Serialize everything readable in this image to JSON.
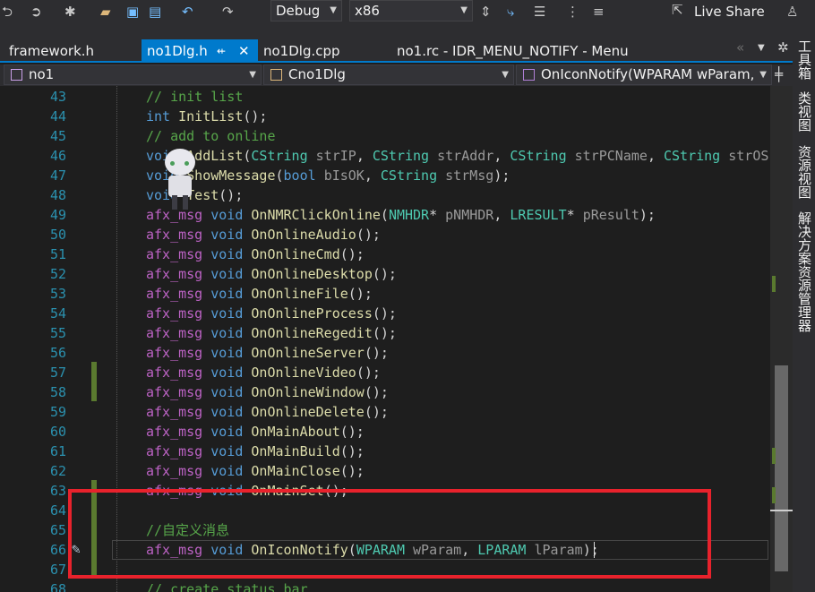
{
  "toolbar": {
    "config": "Debug",
    "platform": "x86",
    "live_share": "Live Share"
  },
  "tabs": [
    {
      "label": "framework.h"
    },
    {
      "label": "no1Dlg.h",
      "pin": "⇷",
      "close": "✕"
    },
    {
      "label": "no1Dlg.cpp"
    },
    {
      "label": "no1.rc - IDR_MENU_NOTIFY - Menu"
    }
  ],
  "navbar": {
    "project": "no1",
    "class": "Cno1Dlg",
    "member": "OnIconNotify(WPARAM wParam,"
  },
  "side_tabs": [
    "工具箱",
    "类视图",
    "资源视图",
    "解决方案资源管理器"
  ],
  "code_lines": [
    {
      "n": "43",
      "tokens": [
        [
          "cm",
          "// init list"
        ]
      ]
    },
    {
      "n": "44",
      "tokens": [
        [
          "kw",
          "int"
        ],
        [
          "",
          " "
        ],
        [
          "fn",
          "InitList"
        ],
        [
          "",
          "();"
        ]
      ]
    },
    {
      "n": "45",
      "tokens": [
        [
          "cm",
          "// add to online"
        ]
      ]
    },
    {
      "n": "46",
      "tokens": [
        [
          "kw",
          "void"
        ],
        [
          "",
          " "
        ],
        [
          "fn",
          "AddList"
        ],
        [
          "",
          "("
        ],
        [
          "ty",
          "CString"
        ],
        [
          "",
          " "
        ],
        [
          "pm",
          "strIP"
        ],
        [
          "",
          ", "
        ],
        [
          "ty",
          "CString"
        ],
        [
          "",
          " "
        ],
        [
          "pm",
          "strAddr"
        ],
        [
          "",
          ", "
        ],
        [
          "ty",
          "CString"
        ],
        [
          "",
          " "
        ],
        [
          "pm",
          "strPCName"
        ],
        [
          "",
          ", "
        ],
        [
          "ty",
          "CString"
        ],
        [
          "",
          " "
        ],
        [
          "pm",
          "strOS"
        ],
        [
          "",
          ","
        ]
      ]
    },
    {
      "n": "47",
      "tokens": [
        [
          "kw",
          "void"
        ],
        [
          "",
          " "
        ],
        [
          "fn",
          "ShowMessage"
        ],
        [
          "",
          "("
        ],
        [
          "kw",
          "bool"
        ],
        [
          "",
          " "
        ],
        [
          "pm",
          "bIsOK"
        ],
        [
          "",
          ", "
        ],
        [
          "ty",
          "CString"
        ],
        [
          "",
          " "
        ],
        [
          "pm",
          "strMsg"
        ],
        [
          "",
          ");"
        ]
      ]
    },
    {
      "n": "48",
      "tokens": [
        [
          "kw",
          "void"
        ],
        [
          "",
          " "
        ],
        [
          "fn",
          "Test"
        ],
        [
          "",
          "();"
        ]
      ]
    },
    {
      "n": "49",
      "tokens": [
        [
          "mc",
          "afx_msg"
        ],
        [
          "",
          " "
        ],
        [
          "kw",
          "void"
        ],
        [
          "",
          " "
        ],
        [
          "fn",
          "OnNMRClickOnline"
        ],
        [
          "",
          "("
        ],
        [
          "ty",
          "NMHDR"
        ],
        [
          "",
          "* "
        ],
        [
          "pm",
          "pNMHDR"
        ],
        [
          "",
          ", "
        ],
        [
          "ty",
          "LRESULT"
        ],
        [
          "",
          "* "
        ],
        [
          "pm",
          "pResult"
        ],
        [
          "",
          ");"
        ]
      ]
    },
    {
      "n": "50",
      "tokens": [
        [
          "mc",
          "afx_msg"
        ],
        [
          "",
          " "
        ],
        [
          "kw",
          "void"
        ],
        [
          "",
          " "
        ],
        [
          "fn",
          "OnOnlineAudio"
        ],
        [
          "",
          "();"
        ]
      ]
    },
    {
      "n": "51",
      "tokens": [
        [
          "mc",
          "afx_msg"
        ],
        [
          "",
          " "
        ],
        [
          "kw",
          "void"
        ],
        [
          "",
          " "
        ],
        [
          "fn",
          "OnOnlineCmd"
        ],
        [
          "",
          "();"
        ]
      ]
    },
    {
      "n": "52",
      "tokens": [
        [
          "mc",
          "afx_msg"
        ],
        [
          "",
          " "
        ],
        [
          "kw",
          "void"
        ],
        [
          "",
          " "
        ],
        [
          "fn",
          "OnOnlineDesktop"
        ],
        [
          "",
          "();"
        ]
      ]
    },
    {
      "n": "53",
      "tokens": [
        [
          "mc",
          "afx_msg"
        ],
        [
          "",
          " "
        ],
        [
          "kw",
          "void"
        ],
        [
          "",
          " "
        ],
        [
          "fn",
          "OnOnlineFile"
        ],
        [
          "",
          "();"
        ]
      ]
    },
    {
      "n": "54",
      "tokens": [
        [
          "mc",
          "afx_msg"
        ],
        [
          "",
          " "
        ],
        [
          "kw",
          "void"
        ],
        [
          "",
          " "
        ],
        [
          "fn",
          "OnOnlineProcess"
        ],
        [
          "",
          "();"
        ]
      ]
    },
    {
      "n": "55",
      "tokens": [
        [
          "mc",
          "afx_msg"
        ],
        [
          "",
          " "
        ],
        [
          "kw",
          "void"
        ],
        [
          "",
          " "
        ],
        [
          "fn",
          "OnOnlineRegedit"
        ],
        [
          "",
          "();"
        ]
      ]
    },
    {
      "n": "56",
      "tokens": [
        [
          "mc",
          "afx_msg"
        ],
        [
          "",
          " "
        ],
        [
          "kw",
          "void"
        ],
        [
          "",
          " "
        ],
        [
          "fn",
          "OnOnlineServer"
        ],
        [
          "",
          "();"
        ]
      ]
    },
    {
      "n": "57",
      "tokens": [
        [
          "mc",
          "afx_msg"
        ],
        [
          "",
          " "
        ],
        [
          "kw",
          "void"
        ],
        [
          "",
          " "
        ],
        [
          "fn",
          "OnOnlineVideo"
        ],
        [
          "",
          "();"
        ]
      ]
    },
    {
      "n": "58",
      "tokens": [
        [
          "mc",
          "afx_msg"
        ],
        [
          "",
          " "
        ],
        [
          "kw",
          "void"
        ],
        [
          "",
          " "
        ],
        [
          "fn",
          "OnOnlineWindow"
        ],
        [
          "",
          "();"
        ]
      ]
    },
    {
      "n": "59",
      "tokens": [
        [
          "mc",
          "afx_msg"
        ],
        [
          "",
          " "
        ],
        [
          "kw",
          "void"
        ],
        [
          "",
          " "
        ],
        [
          "fn",
          "OnOnlineDelete"
        ],
        [
          "",
          "();"
        ]
      ]
    },
    {
      "n": "60",
      "tokens": [
        [
          "mc",
          "afx_msg"
        ],
        [
          "",
          " "
        ],
        [
          "kw",
          "void"
        ],
        [
          "",
          " "
        ],
        [
          "fn",
          "OnMainAbout"
        ],
        [
          "",
          "();"
        ]
      ]
    },
    {
      "n": "61",
      "tokens": [
        [
          "mc",
          "afx_msg"
        ],
        [
          "",
          " "
        ],
        [
          "kw",
          "void"
        ],
        [
          "",
          " "
        ],
        [
          "fn",
          "OnMainBuild"
        ],
        [
          "",
          "();"
        ]
      ]
    },
    {
      "n": "62",
      "tokens": [
        [
          "mc",
          "afx_msg"
        ],
        [
          "",
          " "
        ],
        [
          "kw",
          "void"
        ],
        [
          "",
          " "
        ],
        [
          "fn",
          "OnMainClose"
        ],
        [
          "",
          "();"
        ]
      ]
    },
    {
      "n": "63",
      "tokens": [
        [
          "mc",
          "afx_msg"
        ],
        [
          "",
          " "
        ],
        [
          "kw",
          "void"
        ],
        [
          "",
          " "
        ],
        [
          "fn",
          "OnMainSet"
        ],
        [
          "",
          "();"
        ]
      ]
    },
    {
      "n": "64",
      "tokens": []
    },
    {
      "n": "65",
      "tokens": [
        [
          "cm",
          "//自定义消息"
        ]
      ]
    },
    {
      "n": "66",
      "tokens": [
        [
          "mc",
          "afx_msg"
        ],
        [
          "",
          " "
        ],
        [
          "kw",
          "void"
        ],
        [
          "",
          " "
        ],
        [
          "fn",
          "OnIconNotify"
        ],
        [
          "",
          "("
        ],
        [
          "ty",
          "WPARAM"
        ],
        [
          "",
          " "
        ],
        [
          "pm",
          "wParam"
        ],
        [
          "",
          ", "
        ],
        [
          "ty",
          "LPARAM"
        ],
        [
          "",
          " "
        ],
        [
          "pm",
          "lParam"
        ],
        [
          "",
          ");"
        ]
      ]
    },
    {
      "n": "67",
      "tokens": []
    },
    {
      "n": "68",
      "tokens": [
        [
          "cm",
          "// create status bar"
        ]
      ]
    }
  ]
}
